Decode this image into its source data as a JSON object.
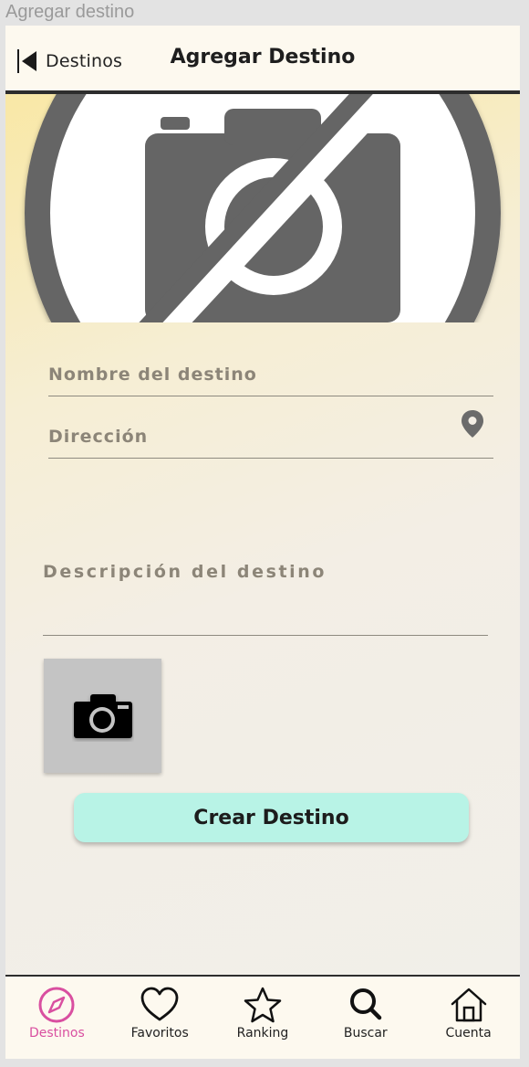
{
  "window": {
    "title": "Agregar destino"
  },
  "header": {
    "back_label": "Destinos",
    "title": "Agregar Destino"
  },
  "form": {
    "name_placeholder": "Nombre del destino",
    "address_placeholder": "Dirección",
    "description_placeholder": "Descripción del destino",
    "submit_label": "Crear Destino"
  },
  "icons": {
    "hero": "no-photo-icon",
    "address": "map-pin-icon",
    "photo_upload": "camera-icon"
  },
  "nav": {
    "items": [
      {
        "label": "Destinos",
        "icon": "compass-icon",
        "active": true
      },
      {
        "label": "Favoritos",
        "icon": "heart-icon",
        "active": false
      },
      {
        "label": "Ranking",
        "icon": "star-icon",
        "active": false
      },
      {
        "label": "Buscar",
        "icon": "search-icon",
        "active": false
      },
      {
        "label": "Cuenta",
        "icon": "home-icon",
        "active": false
      }
    ]
  },
  "colors": {
    "accent": "#d94fa0",
    "button": "#b8f3e6",
    "header_bg": "#fdf9ef",
    "placeholder": "#8c8578"
  }
}
